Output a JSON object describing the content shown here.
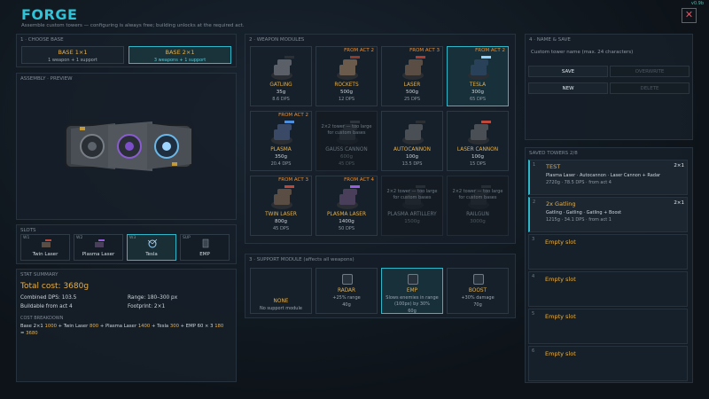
{
  "header": {
    "version": "v0.9b",
    "title": "FORGE",
    "subtitle": "Assemble custom towers — configuring is always free; building unlocks at the required act.",
    "close": "✕"
  },
  "choose_base": {
    "title": "1 · CHOOSE BASE",
    "options": [
      {
        "name": "BASE 1×1",
        "desc": "1 weapon + 1 support"
      },
      {
        "name": "BASE 2×1",
        "desc": "3 weapons + 1 support",
        "selected": true
      }
    ]
  },
  "assembly": {
    "title": "ASSEMBLY · PREVIEW"
  },
  "slots": {
    "title": "SLOTS",
    "items": [
      {
        "tag": "W1",
        "label": "Twin Laser"
      },
      {
        "tag": "W2",
        "label": "Plasma Laser"
      },
      {
        "tag": "W3",
        "label": "Tesla",
        "selected": true
      },
      {
        "tag": "SUP",
        "label": "EMP"
      }
    ]
  },
  "stats": {
    "title": "STAT SUMMARY",
    "total_cost": "Total cost: 3680g",
    "combined_dps": "Combined DPS: 103.5",
    "buildable": "Buildable from act 4",
    "range": "Range: 180–300 px",
    "footprint": "Footprint: 2×1",
    "breakdown_title": "COST BREAKDOWN",
    "breakdown": [
      {
        "t": "Base 2×1 ",
        "v": "1000"
      },
      {
        "t": " + Twin Laser ",
        "v": "800"
      },
      {
        "t": " + Plasma Laser ",
        "v": "1400"
      },
      {
        "t": " + Tesla ",
        "v": "300"
      },
      {
        "t": " + EMP 60 × 3 ",
        "v": "180"
      },
      {
        "t": " = ",
        "v": "3680"
      }
    ]
  },
  "weapons": {
    "title": "2 · WEAPON MODULES",
    "cards": [
      {
        "name": "GATLING",
        "price": "35g",
        "dps": "8.6 DPS",
        "act": ""
      },
      {
        "name": "ROCKETS",
        "price": "500g",
        "dps": "12 DPS",
        "act": "FROM ACT 2"
      },
      {
        "name": "LASER",
        "price": "500g",
        "dps": "25 DPS",
        "act": "FROM ACT 3"
      },
      {
        "name": "TESLA",
        "price": "300g",
        "dps": "65 DPS",
        "act": "FROM ACT 2",
        "selected": true
      },
      {
        "name": "PLASMA",
        "price": "350g",
        "dps": "20.4 DPS",
        "act": "FROM ACT 2"
      },
      {
        "name": "GAUSS CANNON",
        "price": "600g",
        "dps": "45 DPS",
        "act": "",
        "disabled": true,
        "warn": "2×2 tower — too large for custom bases"
      },
      {
        "name": "AUTOCANNON",
        "price": "100g",
        "dps": "13.5 DPS",
        "act": ""
      },
      {
        "name": "LASER CANNON",
        "price": "100g",
        "dps": "15 DPS",
        "act": ""
      },
      {
        "name": "TWIN LASER",
        "price": "800g",
        "dps": "45 DPS",
        "act": "FROM ACT 3"
      },
      {
        "name": "PLASMA LASER",
        "price": "1400g",
        "dps": "50 DPS",
        "act": "FROM ACT 4"
      },
      {
        "name": "PLASMA ARTILLERY",
        "price": "1500g",
        "dps": "",
        "act": "",
        "disabled": true,
        "warn": "2×2 tower — too large for custom bases"
      },
      {
        "name": "RAILGUN",
        "price": "3000g",
        "dps": "",
        "act": "",
        "disabled": true,
        "warn": "2×2 tower — too large for custom bases"
      }
    ]
  },
  "support": {
    "title": "3 · SUPPORT MODULE (affects all weapons)",
    "cards": [
      {
        "name": "NONE",
        "desc": "No support module",
        "price": ""
      },
      {
        "name": "RADAR",
        "desc": "+25% range",
        "price": "40g"
      },
      {
        "name": "EMP",
        "desc": "Slows enemies in range (100px) by 30%",
        "price": "60g",
        "selected": true
      },
      {
        "name": "BOOST",
        "desc": "+30% damage",
        "price": "70g"
      }
    ]
  },
  "name_save": {
    "title": "4 · NAME & SAVE",
    "placeholder": "Custom tower name (max. 24 characters)",
    "save": "SAVE",
    "overwrite": "OVERWRITE",
    "new": "NEW",
    "delete": "DELETE"
  },
  "saved_towers": {
    "title": "SAVED TOWERS 2/8",
    "items": [
      {
        "idx": "1",
        "name": "TEST",
        "base": "2×1",
        "modules": "Plasma Laser · Autocannon · Laser Cannon + Radar",
        "stats": "2720g · 78.5 DPS · from act 4"
      },
      {
        "idx": "2",
        "name": "2x Gatling",
        "base": "2×1",
        "modules": "Gatling · Gatling · Gatling + Boost",
        "stats": "1215g · 34.1 DPS · from act 1"
      },
      {
        "idx": "3",
        "empty": "Empty slot"
      },
      {
        "idx": "4",
        "empty": "Empty slot"
      },
      {
        "idx": "5",
        "empty": "Empty slot"
      },
      {
        "idx": "6",
        "empty": "Empty slot"
      }
    ]
  },
  "colors": {
    "accent": "#2ec3d6",
    "gold": "#e7b04a",
    "act": "#e7903a",
    "danger": "#e05565"
  }
}
